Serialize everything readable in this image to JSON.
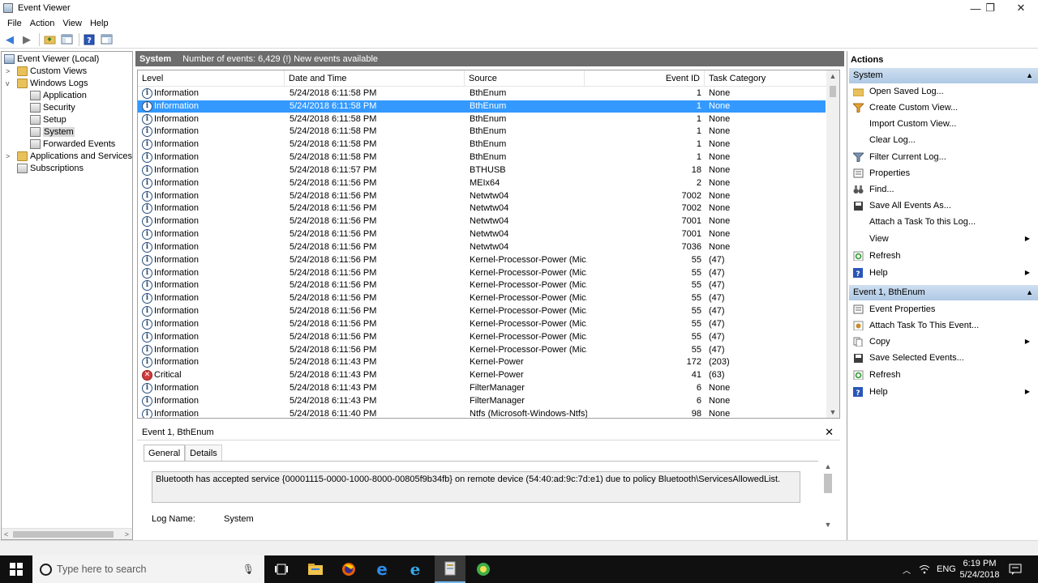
{
  "window": {
    "title": "Event Viewer",
    "minimize": "—",
    "maximize": "❐",
    "close": "✕"
  },
  "menu": [
    "File",
    "Action",
    "View",
    "Help"
  ],
  "tree": {
    "root": "Event Viewer (Local)",
    "custom_views": "Custom Views",
    "windows_logs": "Windows Logs",
    "logs": [
      "Application",
      "Security",
      "Setup",
      "System",
      "Forwarded Events"
    ],
    "apps_services": "Applications and Services Lo",
    "subscriptions": "Subscriptions"
  },
  "center": {
    "log_name": "System",
    "summary": "Number of events: 6,429 (!) New events available"
  },
  "grid": {
    "columns": [
      "Level",
      "Date and Time",
      "Source",
      "Event ID",
      "Task Category"
    ],
    "rows": [
      [
        "Information",
        "5/24/2018 6:11:58 PM",
        "BthEnum",
        "1",
        "None"
      ],
      [
        "Information",
        "5/24/2018 6:11:58 PM",
        "BthEnum",
        "1",
        "None"
      ],
      [
        "Information",
        "5/24/2018 6:11:58 PM",
        "BthEnum",
        "1",
        "None"
      ],
      [
        "Information",
        "5/24/2018 6:11:58 PM",
        "BthEnum",
        "1",
        "None"
      ],
      [
        "Information",
        "5/24/2018 6:11:58 PM",
        "BthEnum",
        "1",
        "None"
      ],
      [
        "Information",
        "5/24/2018 6:11:58 PM",
        "BthEnum",
        "1",
        "None"
      ],
      [
        "Information",
        "5/24/2018 6:11:57 PM",
        "BTHUSB",
        "18",
        "None"
      ],
      [
        "Information",
        "5/24/2018 6:11:56 PM",
        "MEIx64",
        "2",
        "None"
      ],
      [
        "Information",
        "5/24/2018 6:11:56 PM",
        "Netwtw04",
        "7002",
        "None"
      ],
      [
        "Information",
        "5/24/2018 6:11:56 PM",
        "Netwtw04",
        "7002",
        "None"
      ],
      [
        "Information",
        "5/24/2018 6:11:56 PM",
        "Netwtw04",
        "7001",
        "None"
      ],
      [
        "Information",
        "5/24/2018 6:11:56 PM",
        "Netwtw04",
        "7001",
        "None"
      ],
      [
        "Information",
        "5/24/2018 6:11:56 PM",
        "Netwtw04",
        "7036",
        "None"
      ],
      [
        "Information",
        "5/24/2018 6:11:56 PM",
        "Kernel-Processor-Power (Mic...",
        "55",
        "(47)"
      ],
      [
        "Information",
        "5/24/2018 6:11:56 PM",
        "Kernel-Processor-Power (Mic...",
        "55",
        "(47)"
      ],
      [
        "Information",
        "5/24/2018 6:11:56 PM",
        "Kernel-Processor-Power (Mic...",
        "55",
        "(47)"
      ],
      [
        "Information",
        "5/24/2018 6:11:56 PM",
        "Kernel-Processor-Power (Mic...",
        "55",
        "(47)"
      ],
      [
        "Information",
        "5/24/2018 6:11:56 PM",
        "Kernel-Processor-Power (Mic...",
        "55",
        "(47)"
      ],
      [
        "Information",
        "5/24/2018 6:11:56 PM",
        "Kernel-Processor-Power (Mic...",
        "55",
        "(47)"
      ],
      [
        "Information",
        "5/24/2018 6:11:56 PM",
        "Kernel-Processor-Power (Mic...",
        "55",
        "(47)"
      ],
      [
        "Information",
        "5/24/2018 6:11:56 PM",
        "Kernel-Processor-Power (Mic...",
        "55",
        "(47)"
      ],
      [
        "Information",
        "5/24/2018 6:11:43 PM",
        "Kernel-Power",
        "172",
        "(203)"
      ],
      [
        "Critical",
        "5/24/2018 6:11:43 PM",
        "Kernel-Power",
        "41",
        "(63)"
      ],
      [
        "Information",
        "5/24/2018 6:11:43 PM",
        "FilterManager",
        "6",
        "None"
      ],
      [
        "Information",
        "5/24/2018 6:11:43 PM",
        "FilterManager",
        "6",
        "None"
      ],
      [
        "Information",
        "5/24/2018 6:11:40 PM",
        "Ntfs (Microsoft-Windows-Ntfs)",
        "98",
        "None"
      ]
    ]
  },
  "detail": {
    "title": "Event 1, BthEnum",
    "tabs": [
      "General",
      "Details"
    ],
    "description": "Bluetooth has accepted service {00001115-0000-1000-8000-00805f9b34fb} on remote device (54:40:ad:9c:7d:e1) due to policy Bluetooth\\ServicesAllowedList.",
    "log_name_label": "Log Name:",
    "log_name_value": "System"
  },
  "actions": {
    "title": "Actions",
    "system_section": "System",
    "system_items": [
      "Open Saved Log...",
      "Create Custom View...",
      "Import Custom View...",
      "Clear Log...",
      "Filter Current Log...",
      "Properties",
      "Find...",
      "Save All Events As...",
      "Attach a Task To this Log...",
      "View",
      "Refresh",
      "Help"
    ],
    "event_section": "Event 1, BthEnum",
    "event_items": [
      "Event Properties",
      "Attach Task To This Event...",
      "Copy",
      "Save Selected Events...",
      "Refresh",
      "Help"
    ]
  },
  "taskbar": {
    "search_placeholder": "Type here to search",
    "language": "ENG",
    "time": "6:19 PM",
    "date": "5/24/2018"
  }
}
